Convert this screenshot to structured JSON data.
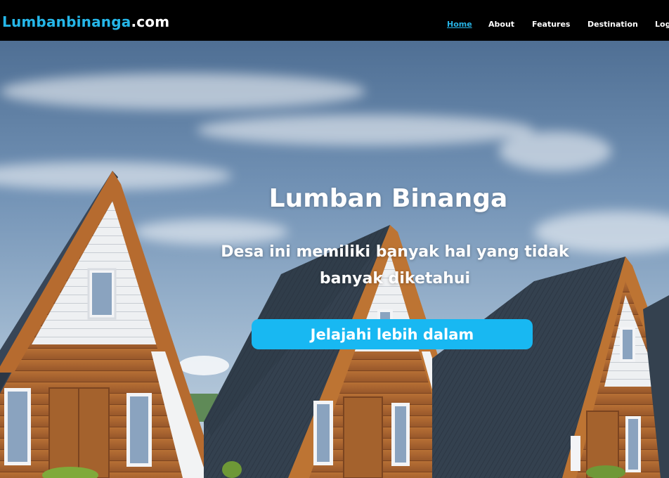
{
  "brand": {
    "name": "Lumbanbinanga",
    "tld": ".com"
  },
  "nav": {
    "items": [
      "Home",
      "About",
      "Features",
      "Destination",
      "Log"
    ],
    "active": "Home"
  },
  "hero": {
    "title": "Lumban Binanga",
    "subtitle": "Desa ini memiliki banyak hal yang tidak banyak diketahui",
    "cta_label": "Jelajahi lebih dalam"
  },
  "colors": {
    "accent": "#18b8f2",
    "brand_blue": "#25b6e8",
    "navbar_bg": "#000000"
  }
}
